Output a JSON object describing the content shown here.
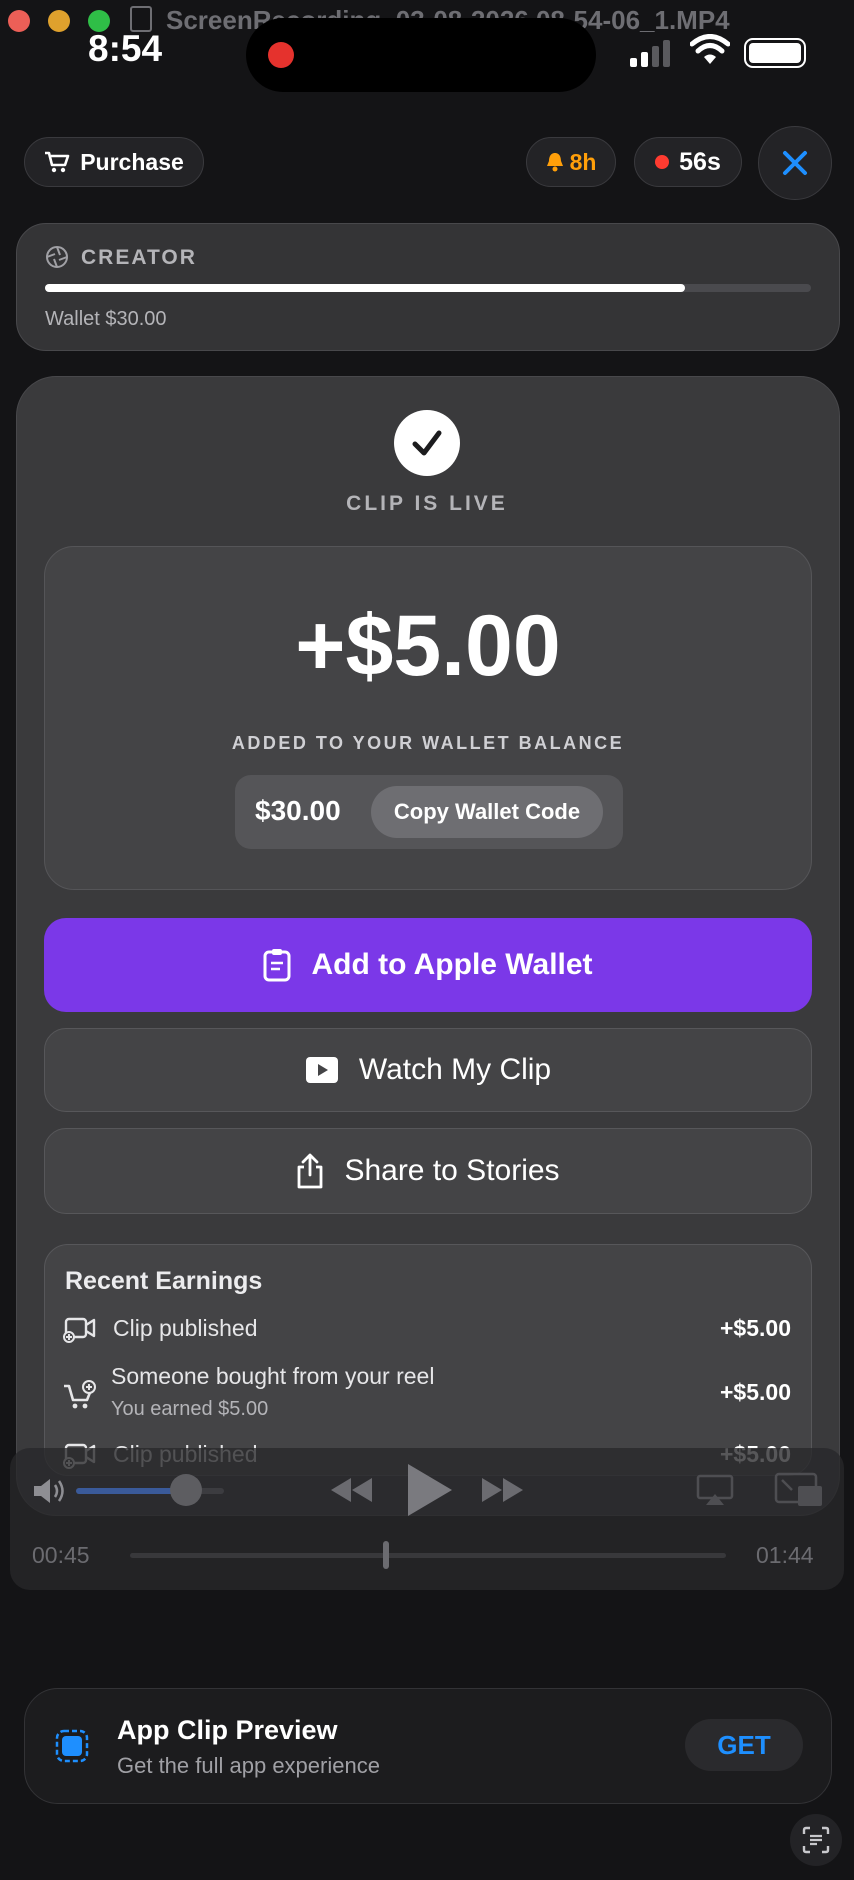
{
  "window": {
    "title": "ScreenRecording_03-08-2026 08-54-06_1.MP4",
    "traffic_colors": [
      "#ec5f57",
      "#dfa12d",
      "#2fbe47"
    ]
  },
  "status_bar": {
    "time": "8:54",
    "battery_level": 1.0,
    "icons": [
      "recording-dot-icon",
      "signal-bars-icon",
      "wifi-icon",
      "battery-icon"
    ]
  },
  "top_bar": {
    "purchase_label": "Purchase",
    "notification_count": "8h",
    "recording_time": "56s",
    "close_icon": "close-icon"
  },
  "creator": {
    "label": "CREATOR",
    "progress": 0.835,
    "wallet_text": "Wallet $30.00"
  },
  "clip": {
    "status": "CLIP IS LIVE",
    "amount": "+$5.00",
    "amount_caption": "ADDED TO YOUR WALLET BALANCE",
    "balance": "$30.00",
    "copy_label": "Copy Wallet Code"
  },
  "actions": {
    "apple_wallet": "Add to Apple Wallet",
    "watch_clip": "Watch My Clip",
    "share_stories": "Share to Stories"
  },
  "earnings": {
    "title": "Recent Earnings",
    "items": [
      {
        "label": "Clip published",
        "sub": "",
        "amount": "+$5.00",
        "icon": "video-add-icon"
      },
      {
        "label": "Someone bought from your reel",
        "sub": "You earned $5.00",
        "amount": "+$5.00",
        "icon": "cart-add-icon"
      },
      {
        "label": "Clip published",
        "sub": "",
        "amount": "+$5.00",
        "icon": "video-add-icon"
      }
    ]
  },
  "player": {
    "elapsed": "00:45",
    "remaining": "01:44",
    "progress": 0.43,
    "volume": 0.74
  },
  "app_clip": {
    "title": "App Clip Preview",
    "subtitle": "Get the full app experience",
    "get_label": "GET"
  },
  "colors": {
    "accent_purple": "#7b38e8",
    "link_blue": "#1e8fff",
    "orange": "#ff9f0a",
    "red": "#ff3b30"
  }
}
